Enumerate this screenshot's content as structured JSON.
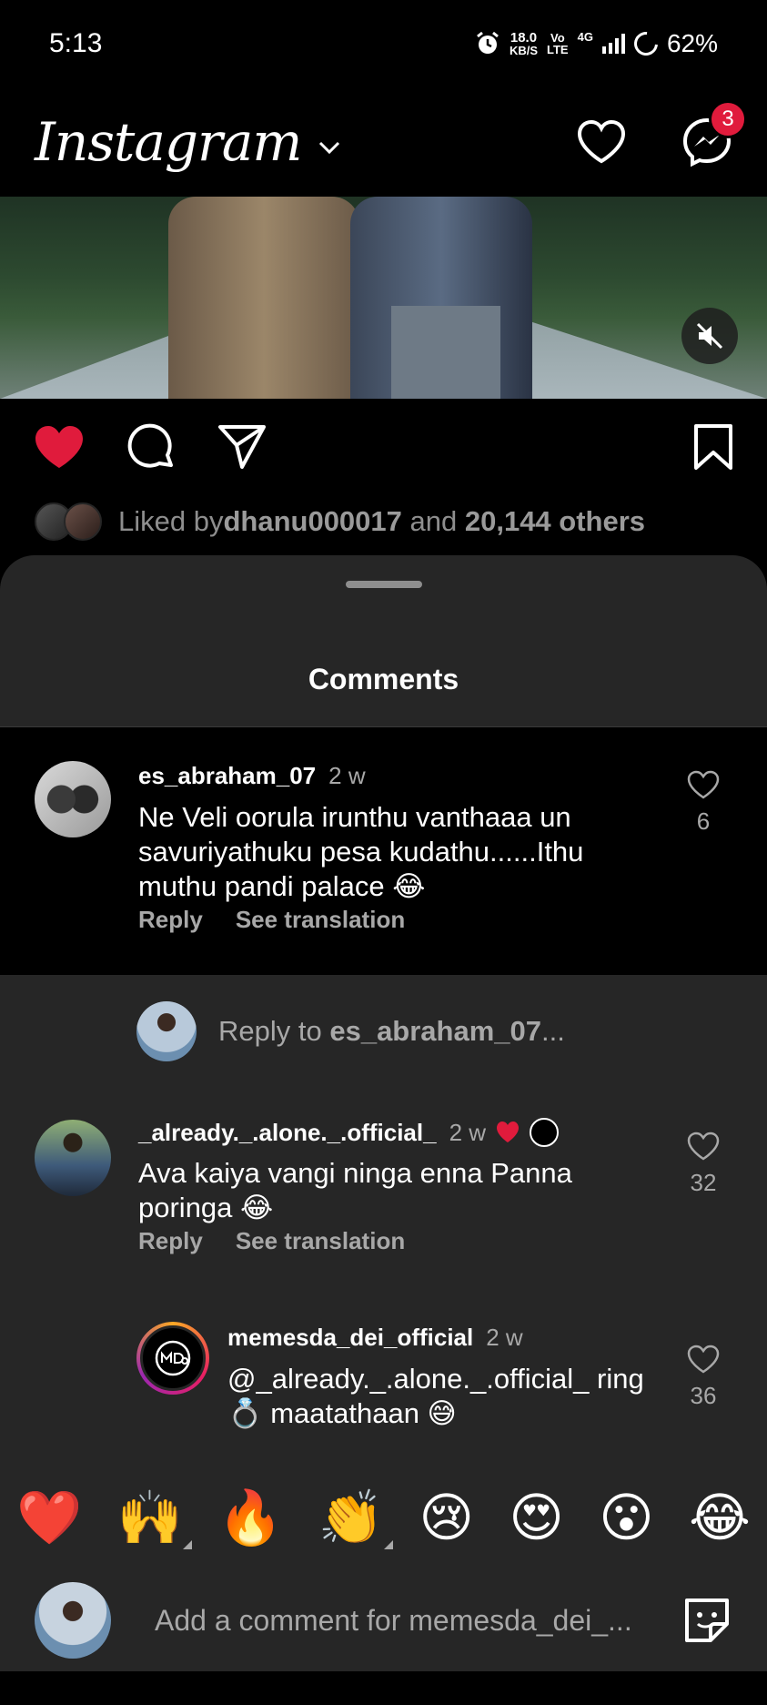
{
  "status_bar": {
    "time": "5:13",
    "net_speed_top": "18.0",
    "net_speed_bottom": "KB/S",
    "volte_top": "Vo",
    "volte_bottom": "LTE",
    "network": "4G",
    "battery": "62%"
  },
  "header": {
    "logo": "Instagram",
    "messages_badge": "3"
  },
  "post": {
    "liked_by_prefix": "Liked by ",
    "liked_by_user": "dhanu000017",
    "liked_by_and": " and ",
    "liked_by_others": "20,144 others"
  },
  "sheet": {
    "title": "Comments"
  },
  "comments": [
    {
      "username": "es_abraham_07",
      "time": "2 w",
      "text": "Ne Veli oorula irunthu vanthaaa un savuriyathuku pesa kudathu......Ithu muthu pandi palace 😂",
      "likes": "6",
      "reply_label": "Reply",
      "translate_label": "See translation"
    },
    {
      "username": "_already._.alone._.official_",
      "time": "2 w",
      "text": "Ava kaiya vangi ninga enna Panna poringa 😂",
      "likes": "32",
      "reply_label": "Reply",
      "translate_label": "See translation"
    },
    {
      "username": "memesda_dei_official",
      "time": "2 w",
      "text": "@_already._.alone._.official_ ring 💍 maatathaan 😅",
      "likes": "36"
    }
  ],
  "reply_prompt": {
    "prefix": "Reply to ",
    "username": "es_abraham_07",
    "suffix": "..."
  },
  "emoji_bar": [
    "❤️",
    "🙌",
    "🔥",
    "👏",
    "😢",
    "😍",
    "😮",
    "😂"
  ],
  "composer": {
    "placeholder": "Add a comment for memesda_dei_..."
  },
  "colors": {
    "background": "#000000",
    "sheet": "#262626",
    "like_red": "#e01b3c",
    "secondary_text": "#a8a8a8"
  }
}
